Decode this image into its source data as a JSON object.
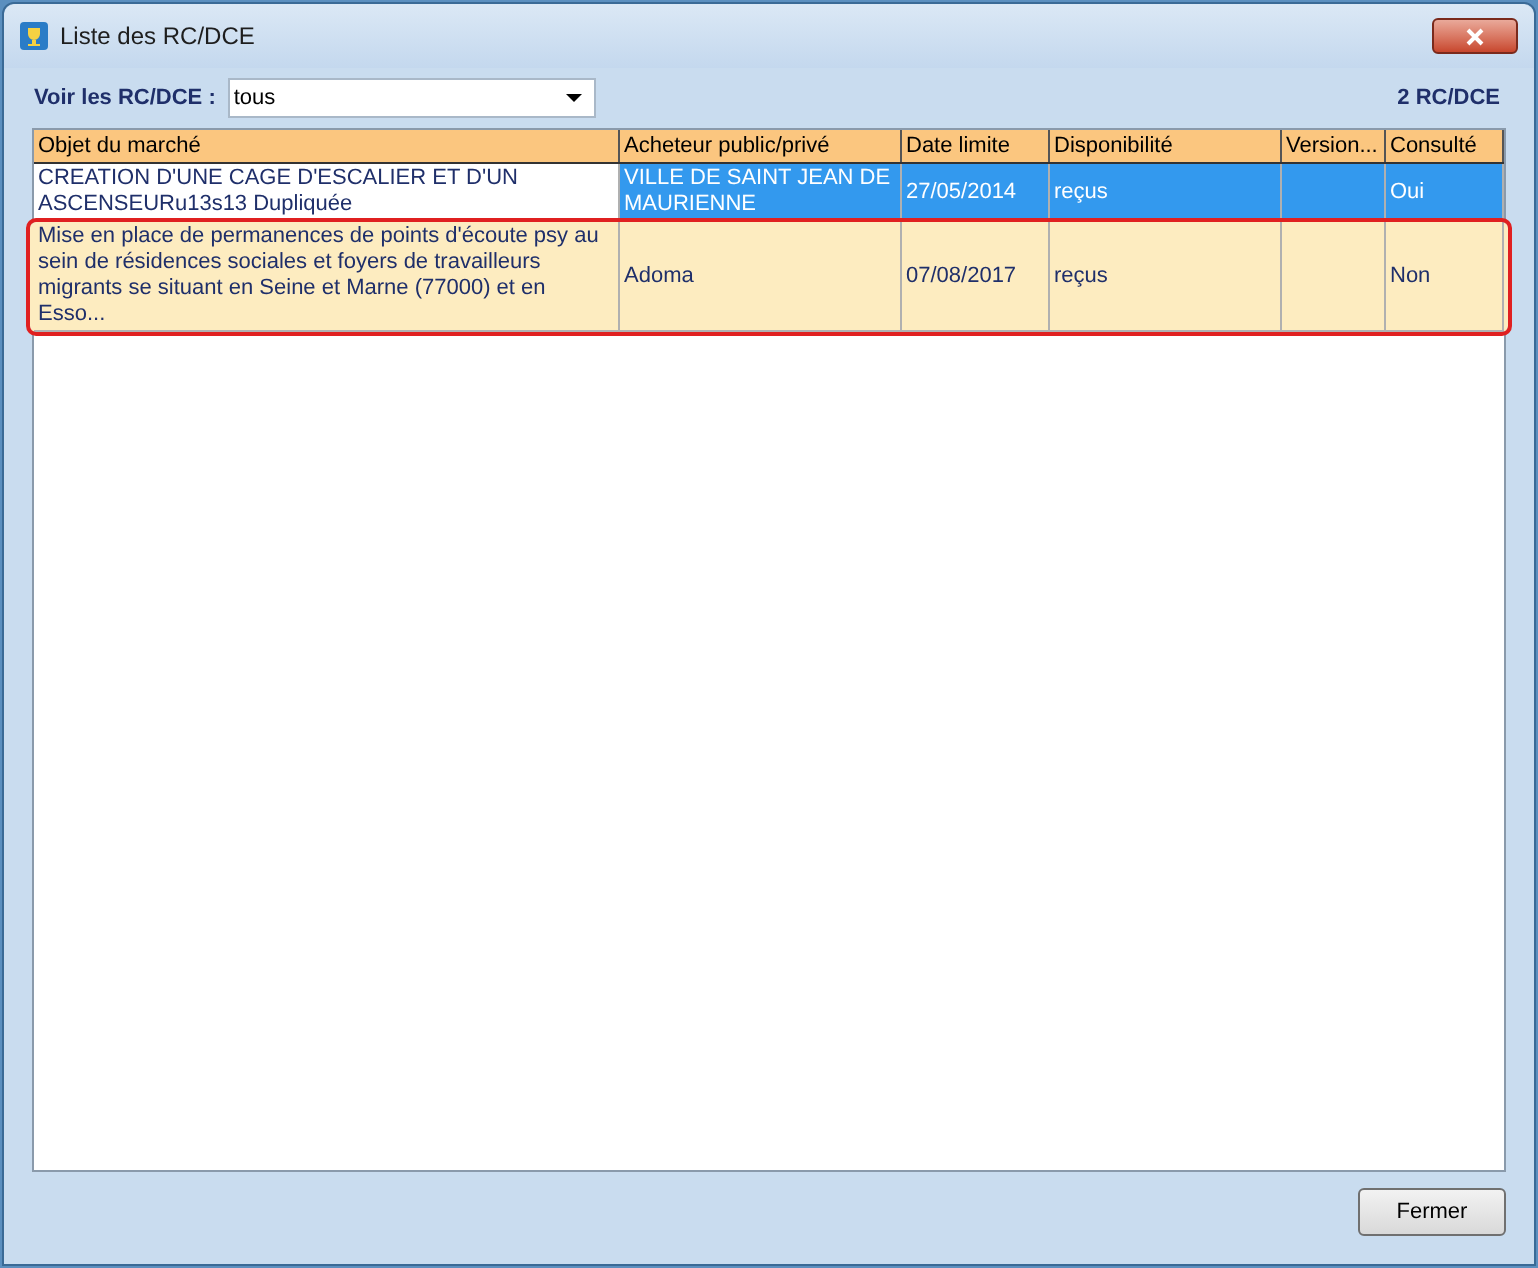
{
  "window": {
    "title": "Liste des RC/DCE"
  },
  "filter": {
    "label": "Voir les RC/DCE :",
    "value": "tous"
  },
  "count": "2 RC/DCE",
  "table": {
    "columns": [
      "Objet du marché",
      "Acheteur public/privé",
      "Date limite",
      "Disponibilité",
      "Version...",
      "Consulté"
    ],
    "rows": [
      {
        "selected": true,
        "outlined": false,
        "cells": [
          "CREATION D'UNE CAGE D'ESCALIER ET D'UN ASCENSEURu13s13 Dupliquée",
          "VILLE DE SAINT JEAN DE MAURIENNE",
          "27/05/2014",
          "reçus",
          "",
          "Oui"
        ]
      },
      {
        "selected": false,
        "outlined": true,
        "cells": [
          "Mise en place de permanences de points d'écoute psy au sein de résidences sociales et foyers de travailleurs migrants se situant en Seine et Marne (77000) et en Esso...",
          "Adoma",
          "07/08/2017",
          "reçus",
          "",
          "Non"
        ]
      }
    ]
  },
  "buttons": [
    "Fermer"
  ]
}
